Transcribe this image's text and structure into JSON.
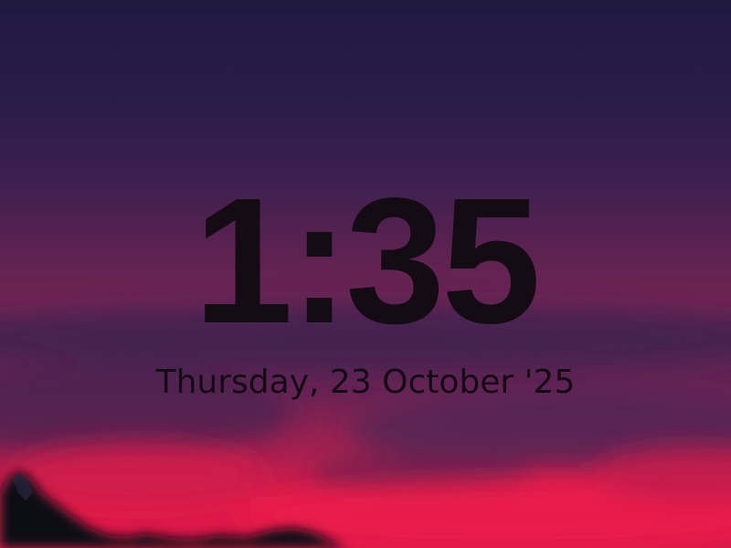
{
  "lockscreen": {
    "time": "1:35",
    "date": "Thursday, 23 October '25"
  },
  "colors": {
    "text": "#140b15",
    "sky_top": "#1f1a40",
    "sky_mid": "#6e2454",
    "sky_glow": "#e01b48",
    "mountain": "#0e0b18"
  }
}
